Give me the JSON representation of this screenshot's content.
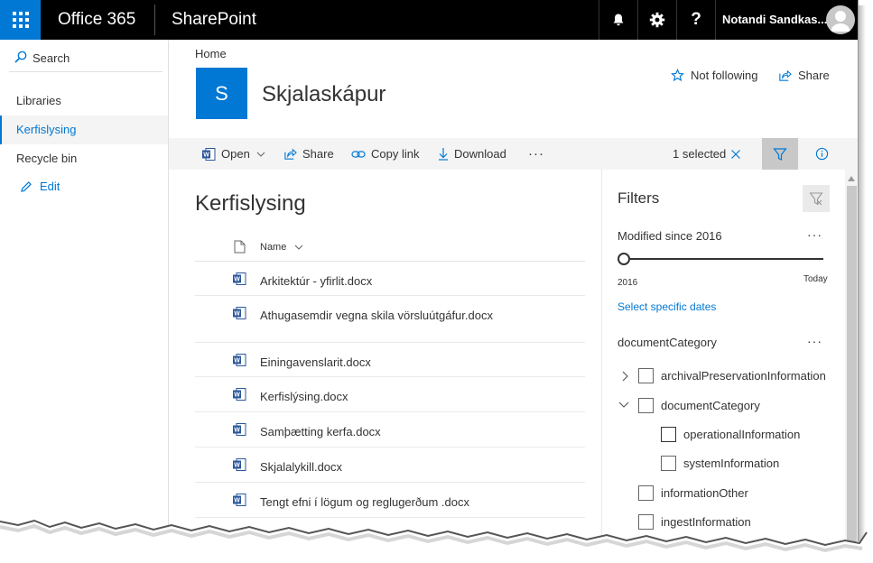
{
  "suite": {
    "brand": "Office 365",
    "app": "SharePoint",
    "help": "?",
    "username": "Notandi Sandkas..."
  },
  "nav": {
    "search_label": "Search",
    "items": [
      {
        "label": "Libraries"
      },
      {
        "label": "Kerfislysing",
        "selected": true
      },
      {
        "label": "Recycle bin"
      }
    ],
    "edit_label": "Edit"
  },
  "site": {
    "breadcrumb": "Home",
    "logo_letter": "S",
    "title": "Skjalaskápur",
    "follow_label": "Not following",
    "share_label": "Share"
  },
  "commands": {
    "open": "Open",
    "share": "Share",
    "copy_link": "Copy link",
    "download": "Download",
    "more": "···",
    "selected_count": "1 selected"
  },
  "list": {
    "title": "Kerfislysing",
    "column_name": "Name",
    "files": [
      {
        "name": "Arkitektúr - yfirlit.docx"
      },
      {
        "name": "Athugasemdir vegna skila vörsluútgáfur.docx"
      },
      {
        "name": "Einingavenslarit.docx"
      },
      {
        "name": "Kerfislýsing.docx"
      },
      {
        "name": "Samþætting kerfa.docx"
      },
      {
        "name": "Skjalalykill.docx"
      },
      {
        "name": "Tengt efni í lögum og reglugerðum .docx"
      }
    ]
  },
  "filters": {
    "title": "Filters",
    "modified": {
      "label": "Modified since 2016",
      "min_label": "2016",
      "max_label": "Today",
      "link": "Select specific dates"
    },
    "category": {
      "label": "documentCategory",
      "options": [
        {
          "label": "archivalPreservationInformation"
        },
        {
          "label": "documentCategory"
        },
        {
          "label": "operationalInformation"
        },
        {
          "label": "systemInformation"
        },
        {
          "label": "informationOther"
        },
        {
          "label": "ingestInformation"
        }
      ]
    },
    "more": "···"
  },
  "colors": {
    "accent": "#0078d4",
    "suitebar": "#000000",
    "commandbar": "#f4f4f4",
    "word_blue": "#2b579a"
  }
}
